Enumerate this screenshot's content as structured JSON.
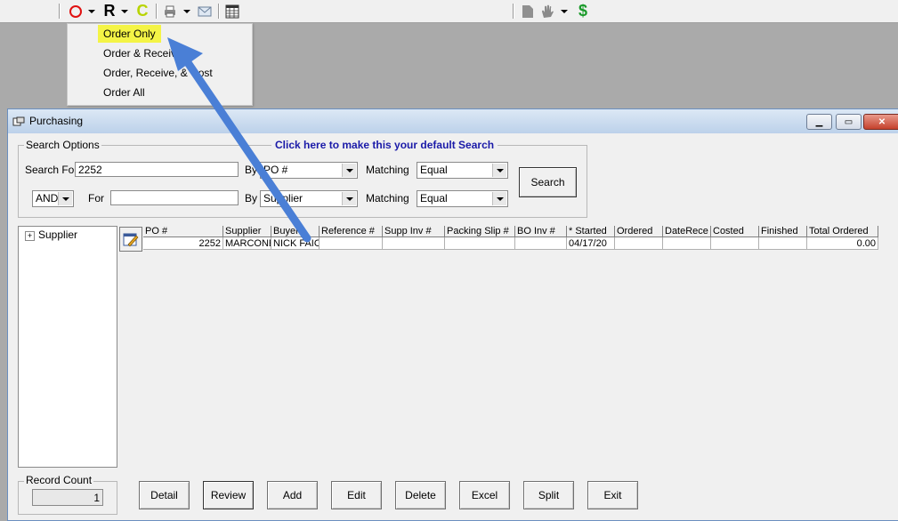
{
  "toolbar": {
    "order_icon": "red-circle-icon",
    "receive_label": "R",
    "cost_label": "C",
    "print_icon": "printer-icon",
    "email_icon": "envelope-icon",
    "grid_icon": "table-icon",
    "cost_icon": "dollar-icon"
  },
  "dropdown": {
    "items": [
      "Order Only",
      "Order & Receive",
      "Order, Receive, & Cost",
      "Order All"
    ]
  },
  "window": {
    "title": "Purchasing"
  },
  "search": {
    "group_title": "Search Options",
    "default_link": "Click here to make this your default Search",
    "search_for_label": "Search For",
    "search_for_value": "2252",
    "by_label": "By",
    "by_value_1": "PO #",
    "matching_label": "Matching",
    "matching_value_1": "Equal",
    "and_value": "AND",
    "for_label": "For",
    "for_value": "",
    "by_value_2": "Supplier",
    "matching_value_2": "Equal",
    "search_button": "Search"
  },
  "tree": {
    "root": "Supplier"
  },
  "grid": {
    "columns": [
      "PO #",
      "Supplier",
      "Buyer",
      "Reference #",
      "Supp Inv #",
      "Packing Slip #",
      "BO Inv #",
      "* Started",
      "Ordered",
      "DateRece",
      "Costed",
      "Finished",
      "Total Ordered"
    ],
    "row": [
      "2252",
      "MARCONE",
      "NICK FAIO",
      "",
      "",
      "",
      "",
      "04/17/20",
      "",
      "",
      "",
      "",
      "0.00"
    ]
  },
  "record_count": {
    "label": "Record Count",
    "value": "1"
  },
  "buttons": {
    "detail": "Detail",
    "review": "Review",
    "add": "Add",
    "edit": "Edit",
    "delete": "Delete",
    "excel": "Excel",
    "split": "Split",
    "exit": "Exit"
  },
  "colors": {
    "highlight": "#f4f446",
    "link": "#1a1aa8",
    "arrow": "#4a7fd6"
  }
}
